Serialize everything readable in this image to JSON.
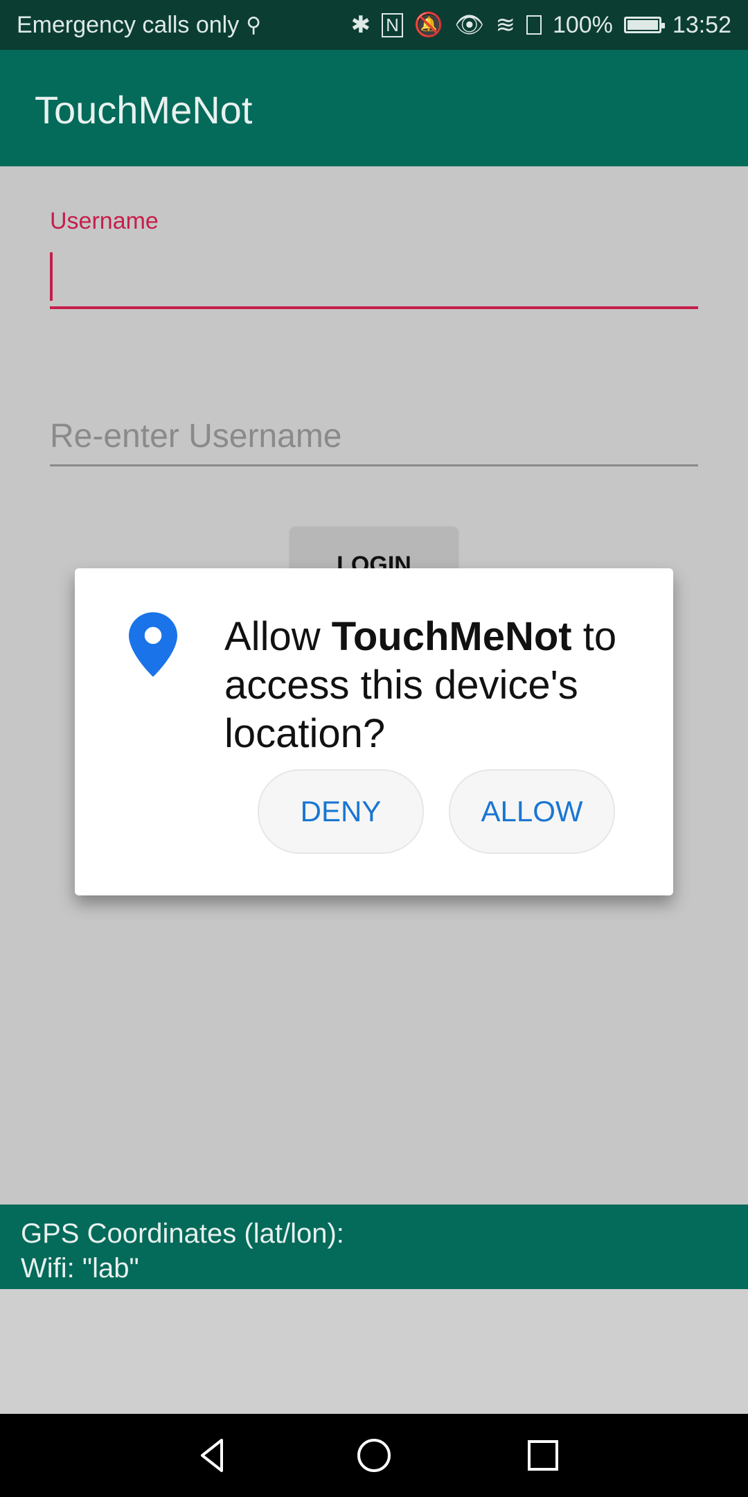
{
  "status_bar": {
    "left_text": "Emergency calls only",
    "battery_text": "100%",
    "time": "13:52",
    "icons": [
      "usb-icon",
      "bluetooth-icon",
      "nfc-icon",
      "mute-icon",
      "eye-icon",
      "wifi-icon",
      "storage-icon",
      "battery-icon"
    ]
  },
  "app": {
    "title": "TouchMeNot"
  },
  "form": {
    "username_label": "Username",
    "reenter_placeholder": "Re-enter Username",
    "login_label": "LOGIN"
  },
  "dialog": {
    "prefix": "Allow",
    "app_name": "TouchMeNot",
    "suffix": "to access this device's location?",
    "deny_label": "DENY",
    "allow_label": "ALLOW",
    "icon": "location-pin-icon"
  },
  "info": {
    "gps_label": "GPS Coordinates (lat/lon):",
    "wifi_text": "Wifi: \"lab\""
  },
  "colors": {
    "status_bar": "#0b3d33",
    "app_bar": "#046a5a",
    "accent": "#c51e4b",
    "dialog_button_text": "#1976d2",
    "location_icon": "#1a73e8"
  }
}
